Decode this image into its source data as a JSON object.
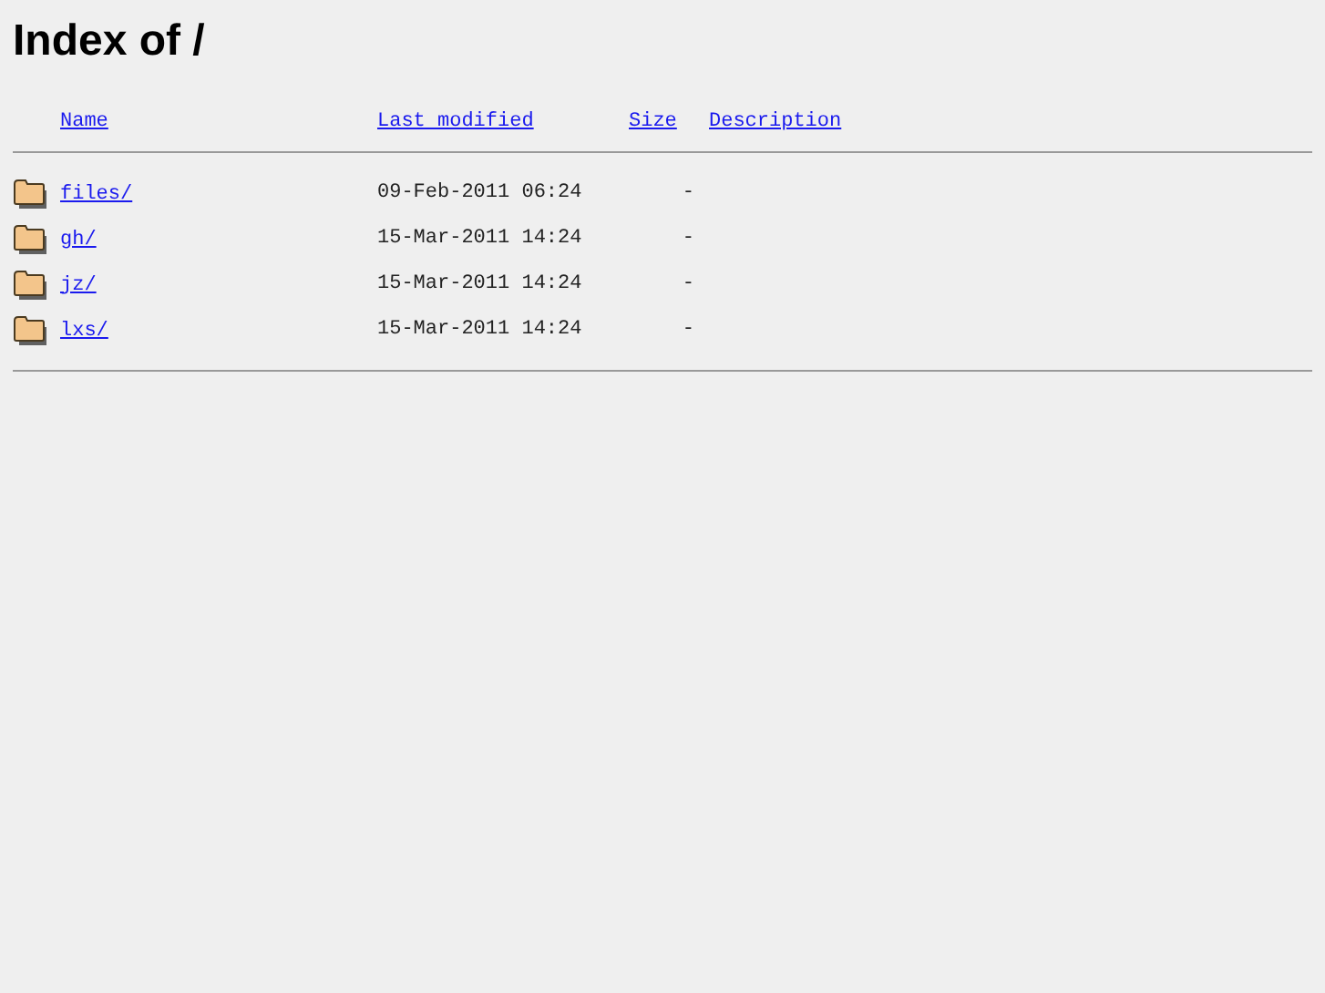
{
  "title": "Index of /",
  "columns": [
    "Name",
    "Last modified",
    "Size",
    "Description"
  ],
  "rows": [
    {
      "name": "files/",
      "modified": "09-Feb-2011 06:24",
      "size": "-"
    },
    {
      "name": "gh/",
      "modified": "15-Mar-2011 14:24",
      "size": "-"
    },
    {
      "name": "jz/",
      "modified": "15-Mar-2011 14:24",
      "size": "-"
    },
    {
      "name": "lxs/",
      "modified": "15-Mar-2011 14:24",
      "size": "-"
    }
  ]
}
